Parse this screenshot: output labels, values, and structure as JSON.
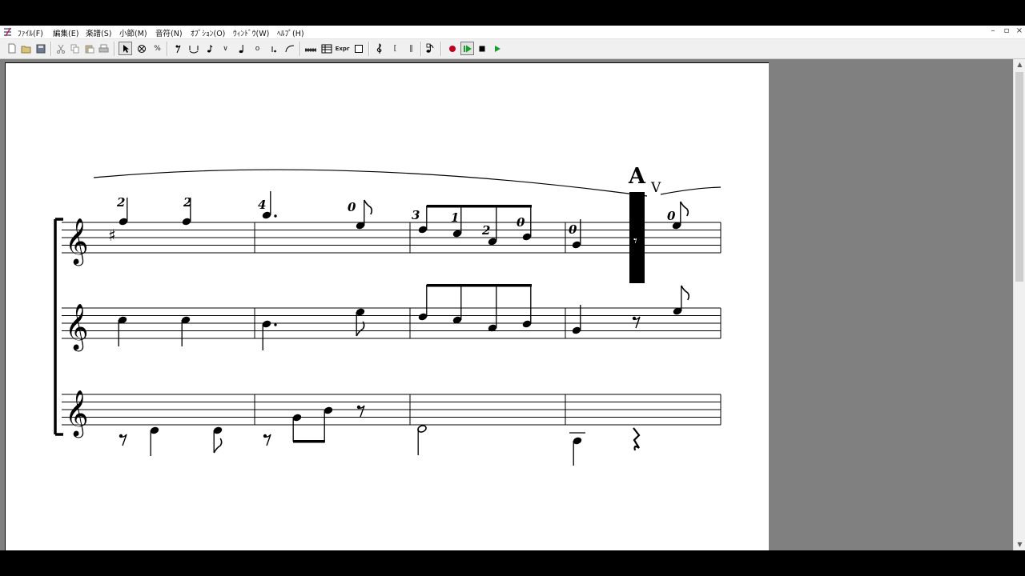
{
  "menubar": {
    "items": [
      "ﾌｧｲﾙ(F)",
      "編集(E)",
      "楽譜(S)",
      "小節(M)",
      "音符(N)",
      "ｵﾌﾟｼｮﾝ(O)",
      "ｳｨﾝﾄﾞｳ(W)",
      "ﾍﾙﾌﾟ(H)"
    ],
    "window_controls": [
      "–",
      "▫",
      "×"
    ]
  },
  "toolbar": {
    "icons": [
      "new-icon",
      "open-icon",
      "save-icon",
      "cut-icon",
      "copy-icon",
      "paste-icon",
      "print-icon",
      "select-arrow-icon",
      "erase-icon",
      "percent-icon",
      "eighth-rest-icon",
      "tie-icon",
      "grace-note-icon",
      "accent-icon",
      "quarter-note-icon",
      "whole-note-icon",
      "dot-icon",
      "slur-icon",
      "tuplet-icon",
      "chord-table-icon",
      "expression-icon",
      "box-icon",
      "clef-icon",
      "bracket-icon",
      "barline-icon",
      "note-input-icon",
      "record-icon",
      "play-from-cursor-icon",
      "stop-icon",
      "play-icon"
    ],
    "glyphs": {
      "percent": "%",
      "eighth_rest": "𝄾",
      "accent": "∨",
      "whole": "o",
      "expr": "Expr",
      "clef": "𝄞",
      "bracket": "[",
      "barline": "‖",
      "stop": "■",
      "play": "▶",
      "rec": "●"
    },
    "colors": {
      "record": "#c0001e",
      "play": "#1a9e2a"
    }
  },
  "score": {
    "rehearsal_mark": "A",
    "bowing_mark": "V",
    "fingerings": [
      "2",
      "2",
      "4",
      "0",
      "3",
      "1",
      "2",
      "0",
      "0",
      "0"
    ],
    "playback_cursor_color": "#000000"
  }
}
